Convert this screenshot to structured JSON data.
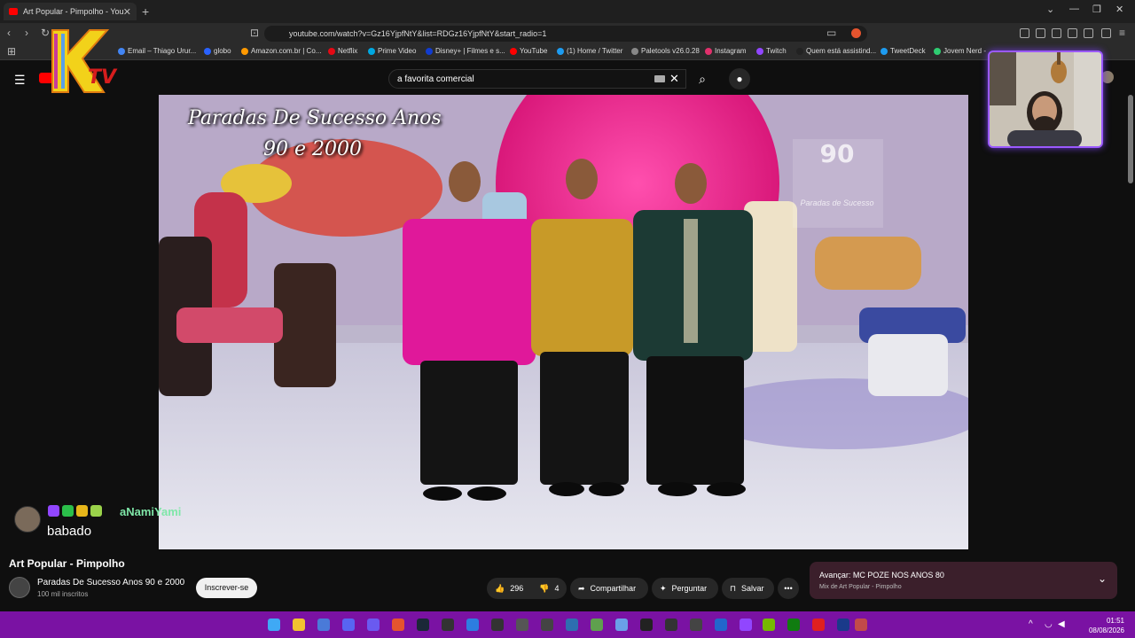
{
  "browser": {
    "tab_title": "Art Popular - Pimpolho - YouTube",
    "url": "youtube.com/watch?v=Gz16YjpfNtY&list=RDGz16YjpfNtY&start_radio=1",
    "bookmarks": [
      {
        "label": "Email – Thiago Urur...",
        "color": "#4285f4"
      },
      {
        "label": "globo",
        "color": "#2962ff"
      },
      {
        "label": "Amazon.com.br | Co...",
        "color": "#ff9900"
      },
      {
        "label": "Netflix",
        "color": "#e50914"
      },
      {
        "label": "Prime Video",
        "color": "#00a8e1"
      },
      {
        "label": "Disney+ | Filmes e s...",
        "color": "#113ccf"
      },
      {
        "label": "YouTube",
        "color": "#ff0000"
      },
      {
        "label": "(1) Home / Twitter",
        "color": "#1d9bf0"
      },
      {
        "label": "Paletools v26.0.28",
        "color": "#888888"
      },
      {
        "label": "Instagram",
        "color": "#e1306c"
      },
      {
        "label": "Twitch",
        "color": "#9146ff"
      },
      {
        "label": "Quem está assistind...",
        "color": "#222222"
      },
      {
        "label": "TweetDeck",
        "color": "#1d9bf0"
      },
      {
        "label": "Jovem Nerd -",
        "color": "#2ecc71"
      }
    ]
  },
  "youtube": {
    "search_value": "a favorita comercial",
    "video_title": "Art Popular - Pimpolho",
    "channel_name": "Paradas De Sucesso Anos 90 e 2000",
    "subscribers": "100 mil inscritos",
    "subscribe_label": "Inscrever-se",
    "likes": "296",
    "dislikes": "4",
    "share_label": "Compartilhar",
    "ask_label": "Perguntar",
    "save_label": "Salvar",
    "next_up_label": "Avançar: MC POZE NOS ANOS 80",
    "next_up_sub": "Mix de Art Popular - Pimpolho"
  },
  "video_overlay": {
    "line1": "Paradas De Sucesso Anos",
    "line2": "90 e 2000",
    "watermark_num": "90",
    "watermark_sub": "Paradas de Sucesso"
  },
  "chat": {
    "username": "aNamiYami",
    "message": "babado"
  },
  "taskbar": {
    "time": "01:51",
    "date": "08/08/2026"
  },
  "colors": {
    "taskbar": "#7a12a3",
    "accent": "#ff0000",
    "webcam_border": "#9b59ff"
  }
}
